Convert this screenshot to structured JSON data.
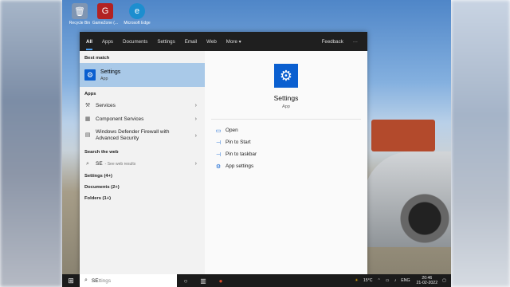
{
  "desktop_icons": [
    {
      "label": "Recycle Bin",
      "glyph": "🗑",
      "color": "#7f95b2"
    },
    {
      "label": "GameZone (...",
      "glyph": "G",
      "color": "#b22222"
    },
    {
      "label": "Microsoft Edge",
      "glyph": "e",
      "color": "#1d8ecf"
    }
  ],
  "menu": {
    "tabs": [
      "All",
      "Apps",
      "Documents",
      "Settings",
      "Email",
      "Web",
      "More ▾"
    ],
    "feedback": "Feedback",
    "more_options": "···",
    "best_match_heading": "Best match",
    "best_match": {
      "title": "Settings",
      "subtitle": "App"
    },
    "apps_heading": "Apps",
    "apps": [
      {
        "label": "Services",
        "icon": "wrench-icon"
      },
      {
        "label": "Component Services",
        "icon": "component-icon"
      },
      {
        "label": "Windows Defender Firewall with Advanced Security",
        "icon": "firewall-icon"
      }
    ],
    "web_heading": "Search the web",
    "web_query": "SE",
    "web_note": "- See web results",
    "settings_count": "Settings (4+)",
    "documents_count": "Documents (2+)",
    "folders_count": "Folders (1+)",
    "preview": {
      "title": "Settings",
      "subtitle": "App",
      "actions": [
        "Open",
        "Pin to Start",
        "Pin to taskbar",
        "App settings"
      ]
    }
  },
  "taskbar": {
    "search_typed": "SE",
    "search_placeholder": "ttings",
    "weather": "15°C",
    "language": "ENG",
    "time": "20:46",
    "date": "21-02-2022"
  }
}
